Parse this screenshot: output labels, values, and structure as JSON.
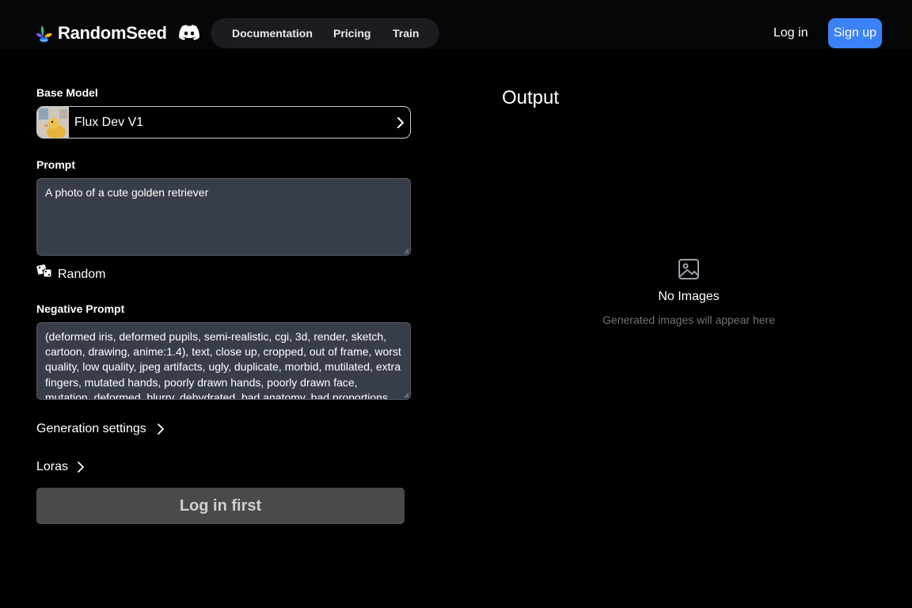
{
  "header": {
    "brand": "RandomSeed",
    "nav": [
      "Documentation",
      "Pricing",
      "Train"
    ],
    "login_label": "Log in",
    "signup_label": "Sign up"
  },
  "form": {
    "base_model_label": "Base Model",
    "base_model_value": "Flux Dev V1",
    "prompt_label": "Prompt",
    "prompt_value": "A photo of a cute golden retriever",
    "random_label": "Random",
    "negative_prompt_label": "Negative Prompt",
    "negative_prompt_value": "(deformed iris, deformed pupils, semi-realistic, cgi, 3d, render, sketch, cartoon, drawing, anime:1.4), text, close up, cropped, out of frame, worst quality, low quality, jpeg artifacts, ugly, duplicate, morbid, mutilated, extra fingers, mutated hands, poorly drawn hands, poorly drawn face, mutation, deformed, blurry, dehydrated, bad anatomy, bad proportions",
    "generation_settings_label": "Generation settings",
    "loras_label": "Loras",
    "submit_label": "Log in first"
  },
  "output": {
    "title": "Output",
    "empty_title": "No Images",
    "empty_subtitle": "Generated images will appear here"
  },
  "icons": {
    "logo": "randomseed-logo-icon",
    "discord": "discord-icon",
    "chevron": "chevron-right-icon",
    "dice": "dice-icon",
    "image_placeholder": "image-icon"
  },
  "colors": {
    "background": "#000000",
    "accent": "#3b82f6",
    "input_bg": "#383d4a",
    "disabled_button": "#4a4a4b"
  }
}
